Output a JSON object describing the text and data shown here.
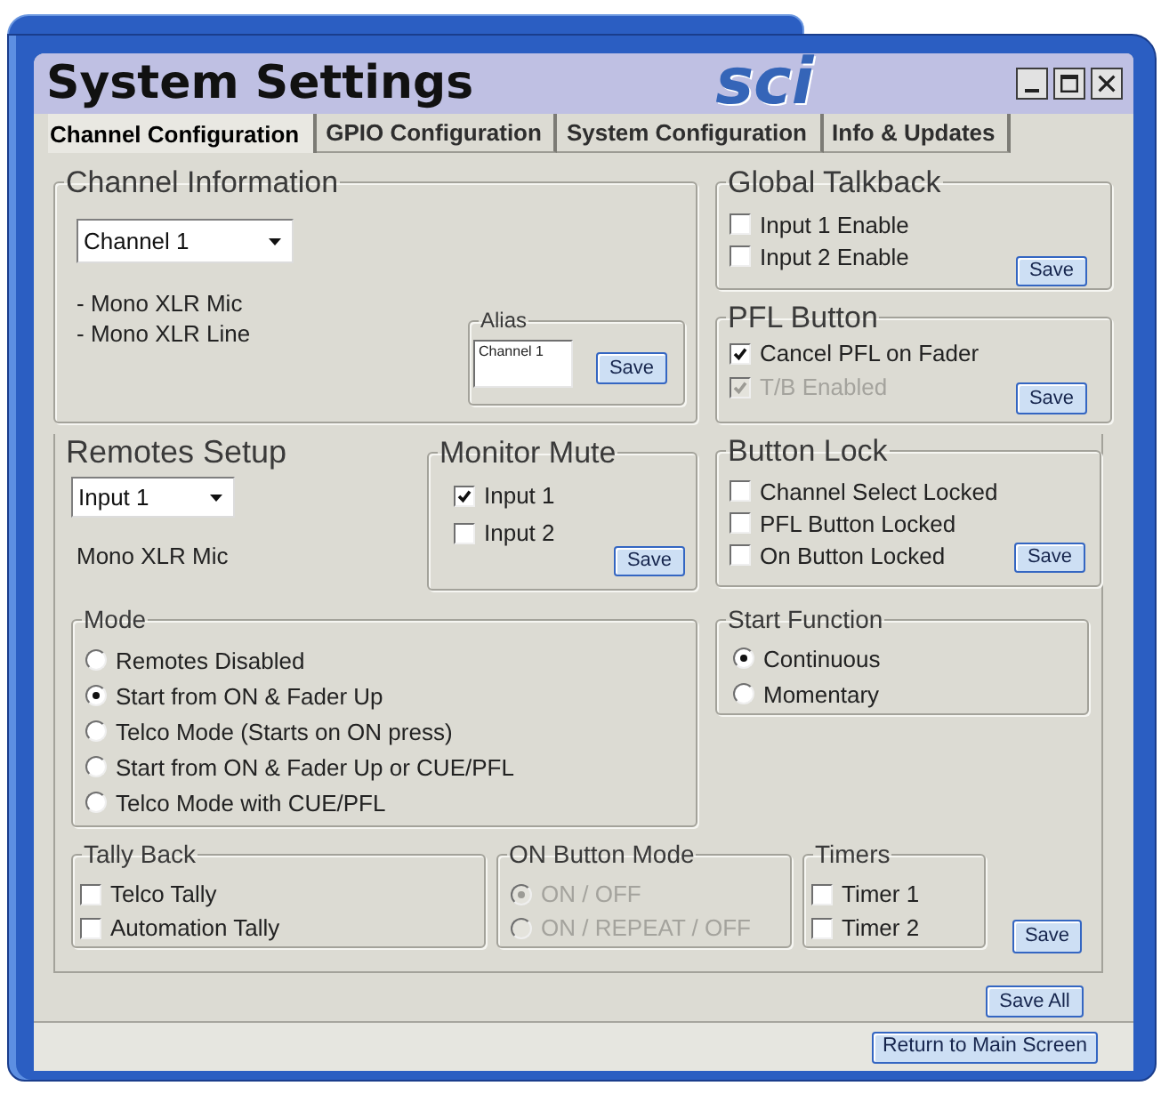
{
  "window": {
    "title": "System Settings",
    "logo": "sci"
  },
  "tabs": [
    {
      "label": "Channel Configuration",
      "selected": true
    },
    {
      "label": "GPIO Configuration",
      "selected": false
    },
    {
      "label": "System Configuration",
      "selected": false
    },
    {
      "label": "Info & Updates",
      "selected": false
    }
  ],
  "channel_information": {
    "title": "Channel Information",
    "channel_select": {
      "value": "Channel 1"
    },
    "details": [
      "- Mono XLR Mic",
      "- Mono XLR Line"
    ],
    "alias": {
      "title": "Alias",
      "value": "Channel 1",
      "button": "Save"
    }
  },
  "global_talkback": {
    "title": "Global Talkback",
    "options": [
      {
        "label": "Input 1 Enable",
        "checked": false
      },
      {
        "label": "Input 2 Enable",
        "checked": false
      }
    ],
    "button": "Save"
  },
  "pfl_button": {
    "title": "PFL Button",
    "options": [
      {
        "label": "Cancel PFL on Fader",
        "checked": true,
        "disabled": false
      },
      {
        "label": "T/B Enabled",
        "checked": true,
        "disabled": true
      }
    ],
    "button": "Save"
  },
  "remotes_setup": {
    "title": "Remotes Setup",
    "input_select": {
      "value": "Input 1"
    },
    "description": "Mono XLR Mic",
    "monitor_mute": {
      "title": "Monitor Mute",
      "options": [
        {
          "label": "Input 1",
          "checked": true
        },
        {
          "label": "Input 2",
          "checked": false
        }
      ],
      "button": "Save"
    },
    "button_lock": {
      "title": "Button Lock",
      "options": [
        {
          "label": "Channel Select Locked",
          "checked": false
        },
        {
          "label": "PFL Button Locked",
          "checked": false
        },
        {
          "label": "On Button Locked",
          "checked": false
        }
      ],
      "button": "Save"
    },
    "mode": {
      "title": "Mode",
      "options": [
        {
          "label": "Remotes Disabled",
          "selected": false
        },
        {
          "label": "Start from ON & Fader Up",
          "selected": true
        },
        {
          "label": "Telco Mode (Starts on ON press)",
          "selected": false
        },
        {
          "label": "Start from ON & Fader Up or CUE/PFL",
          "selected": false
        },
        {
          "label": "Telco Mode with CUE/PFL",
          "selected": false
        }
      ]
    },
    "start_function": {
      "title": "Start Function",
      "options": [
        {
          "label": "Continuous",
          "selected": true
        },
        {
          "label": "Momentary",
          "selected": false
        }
      ]
    },
    "tally_back": {
      "title": "Tally Back",
      "options": [
        {
          "label": "Telco Tally",
          "checked": false
        },
        {
          "label": "Automation Tally",
          "checked": false
        }
      ]
    },
    "on_button_mode": {
      "title": "ON Button Mode",
      "options": [
        {
          "label": "ON / OFF",
          "selected": true,
          "disabled": true
        },
        {
          "label": "ON / REPEAT / OFF",
          "selected": false,
          "disabled": true
        }
      ]
    },
    "timers": {
      "title": "Timers",
      "options": [
        {
          "label": "Timer 1",
          "checked": false
        },
        {
          "label": "Timer 2",
          "checked": false
        }
      ]
    },
    "button": "Save"
  },
  "save_all_button": "Save All",
  "footer": {
    "button": "Return to Main Screen"
  }
}
